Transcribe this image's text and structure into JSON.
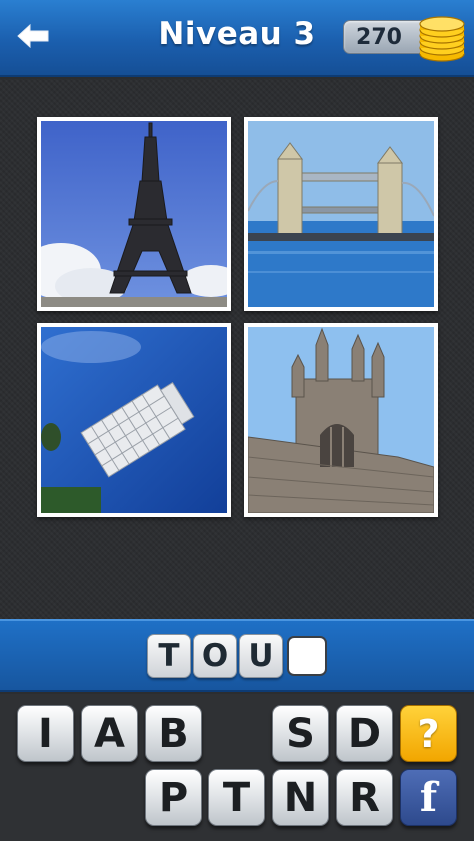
{
  "header": {
    "title": "Niveau 3",
    "coins": "270",
    "back_icon": "back-arrow-icon",
    "coin_icon": "gold-coins-icon"
  },
  "photos": [
    {
      "subject": "Eiffel Tower"
    },
    {
      "subject": "Tower Bridge"
    },
    {
      "subject": "Leaning Tower of Pisa"
    },
    {
      "subject": "Gothic church tower"
    }
  ],
  "answer": {
    "letters": [
      "T",
      "O",
      "U",
      ""
    ]
  },
  "keyboard": {
    "row1": [
      "I",
      "A",
      "B",
      "",
      "S",
      "D"
    ],
    "row2": [
      "P",
      "T",
      "N",
      "R"
    ],
    "hint_label": "?",
    "facebook_label": "f"
  },
  "colors": {
    "header_blue": "#1b5fae",
    "hint_yellow": "#f2a600",
    "facebook_blue": "#3b5998"
  }
}
